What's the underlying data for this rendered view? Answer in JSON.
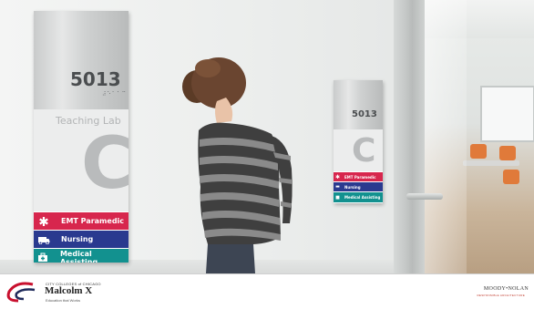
{
  "scene": {
    "large_sign": {
      "room_number": "5013",
      "braille": "⠼⠑⠁⠁⠉",
      "room_name": "Teaching Lab",
      "letter": "C",
      "programs": [
        {
          "label": "EMT Paramedic",
          "color": "#d7264d",
          "icon": "star-of-life-icon"
        },
        {
          "label": "Nursing",
          "color": "#2a3a8f",
          "icon": "ambulance-icon"
        },
        {
          "label": "Medical Assisting",
          "color": "#12918f",
          "icon": "medical-bag-icon"
        }
      ]
    },
    "small_sign": {
      "room_number": "5013",
      "letter": "C",
      "programs": [
        {
          "label": "EMT Paramedic",
          "color": "#d7264d",
          "icon": "star-of-life-icon"
        },
        {
          "label": "Nursing",
          "color": "#2a3a8f",
          "icon": "ambulance-icon"
        },
        {
          "label": "Medical Assisting",
          "color": "#12918f",
          "icon": "medical-bag-icon"
        }
      ]
    }
  },
  "footer": {
    "college_small": "CITY COLLEGES of CHICAGO",
    "college_name": "Malcolm X",
    "college_tagline": "Education that Works",
    "firm_name": "MOODY•NOLAN",
    "firm_sub": "RESPONSIBLE ARCHITECTURE"
  }
}
